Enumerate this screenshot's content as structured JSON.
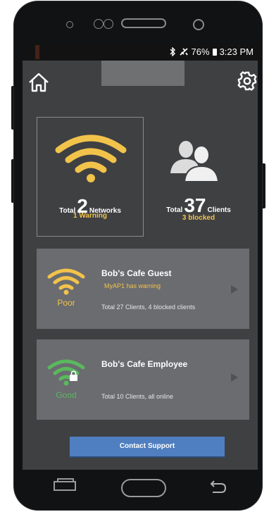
{
  "status_bar": {
    "battery": "76%",
    "time": "3:23 PM",
    "bluetooth_icon": "bluetooth-icon",
    "airplane_icon": "airplane-icon",
    "battery_icon": "battery-icon"
  },
  "app_bar": {
    "home_icon": "home-icon",
    "settings_icon": "gear-icon"
  },
  "summary": {
    "networks": {
      "prefix": "Total",
      "count": "2",
      "unit": "Networks",
      "sub": "1 Warning",
      "icon": "wifi-icon"
    },
    "clients": {
      "prefix": "Total",
      "count": "37",
      "unit": "Clients",
      "sub": "3 blocked",
      "icon": "people-icon"
    }
  },
  "networks": [
    {
      "name": "Bob's Cafe Guest",
      "warning": "MyAP1 has warning",
      "quality": "Poor",
      "clients": "Total 27 Clients, 4 blocked clients",
      "wifi_color": "#f2c34b"
    },
    {
      "name": "Bob's Cafe Employee",
      "warning": "",
      "quality": "Good",
      "clients": "Total 10 Clients, all online",
      "wifi_color": "#5bb85d",
      "lock_icon": "lock-icon"
    }
  ],
  "support_button": "Contact Support",
  "colors": {
    "accent_warning": "#f2c34b",
    "good": "#5bb85d",
    "button_blue": "#4f7fc0",
    "screen_bg": "#3f4042",
    "card_bg": "#6a6c70"
  },
  "nav_bar": {
    "recent_icon": "recent-apps-icon",
    "home_icon": "home-pill-icon",
    "back_icon": "back-arrow-icon"
  }
}
